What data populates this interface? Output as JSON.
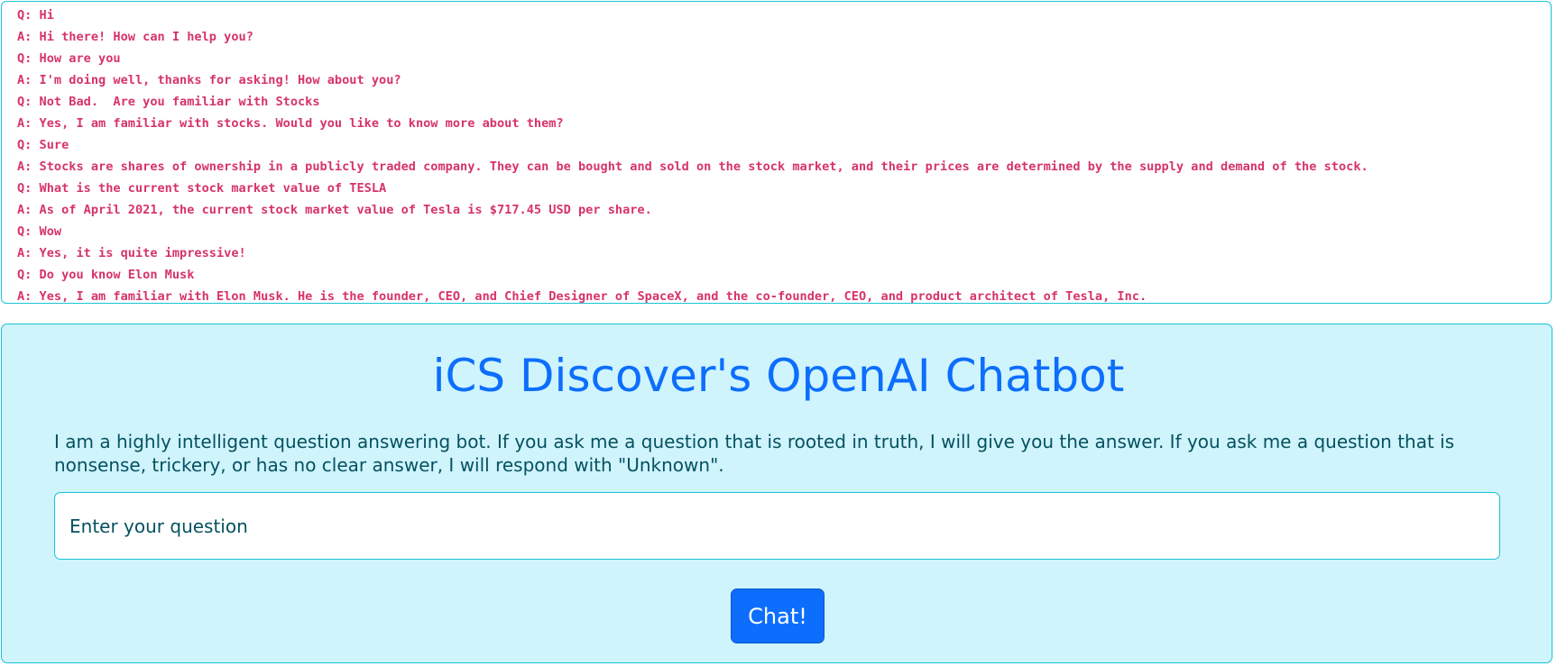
{
  "conversation": [
    "Q: Hi",
    "A: Hi there! How can I help you?",
    "Q: How are you",
    "A: I'm doing well, thanks for asking! How about you?",
    "Q: Not Bad.  Are you familiar with Stocks",
    "A: Yes, I am familiar with stocks. Would you like to know more about them?",
    "Q: Sure",
    "A: Stocks are shares of ownership in a publicly traded company. They can be bought and sold on the stock market, and their prices are determined by the supply and demand of the stock.",
    "Q: What is the current stock market value of TESLA",
    "A: As of April 2021, the current stock market value of Tesla is $717.45 USD per share.",
    "Q: Wow",
    "A: Yes, it is quite impressive!",
    "Q: Do you know Elon Musk",
    "A: Yes, I am familiar with Elon Musk. He is the founder, CEO, and Chief Designer of SpaceX, and the co-founder, CEO, and product architect of Tesla, Inc."
  ],
  "chat": {
    "title": "iCS Discover's OpenAI Chatbot",
    "description": "I am a highly intelligent question answering bot. If you ask me a question that is rooted in truth, I will give you the answer. If you ask me a question that is nonsense, trickery, or has no clear answer, I will respond with \"Unknown\".",
    "input_placeholder": "Enter your question",
    "input_value": "",
    "button_label": "Chat!"
  },
  "colors": {
    "log_text": "#d6336c",
    "panel_border": "#17c3d4",
    "card_background": "#cff4fc",
    "title": "#0d6efd",
    "body_text": "#055160",
    "button_background": "#0d6efd",
    "button_text": "#ffffff"
  }
}
